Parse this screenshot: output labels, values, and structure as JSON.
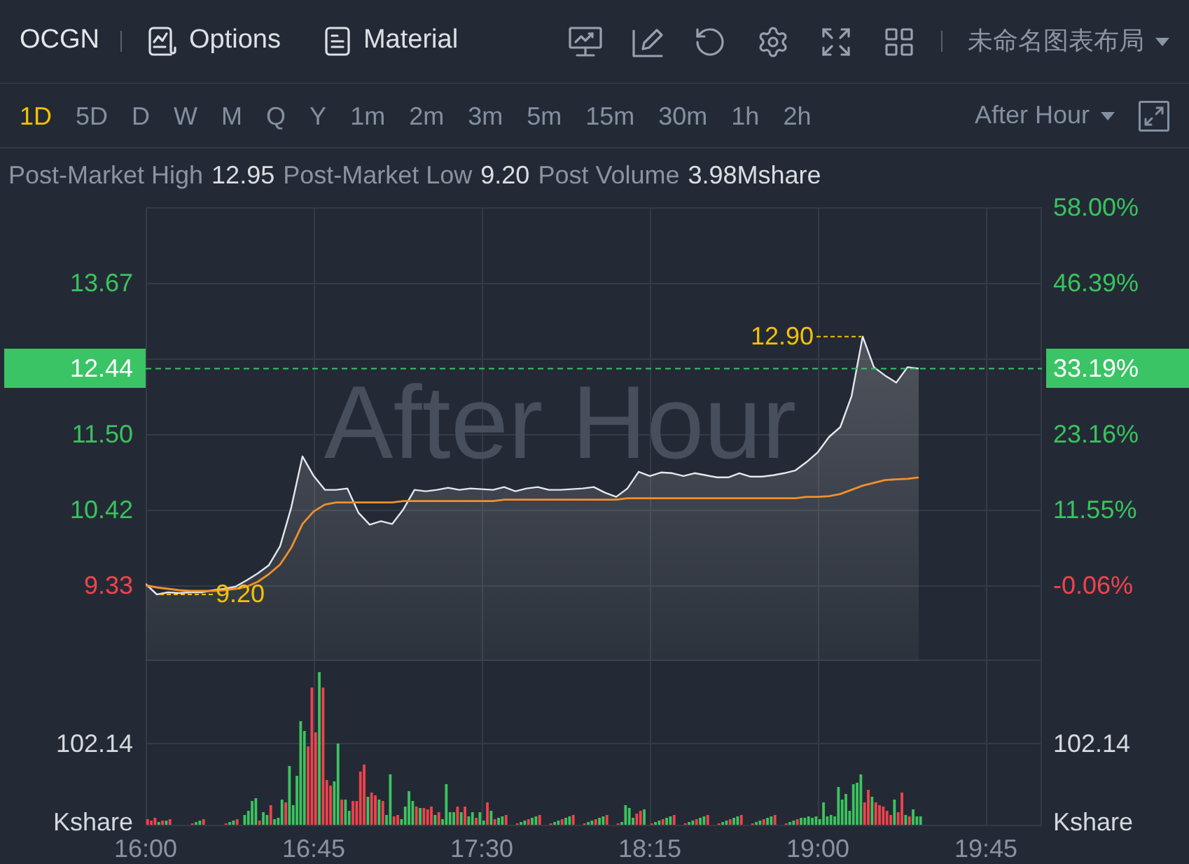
{
  "header": {
    "symbol": "OCGN",
    "buttons": [
      {
        "label": "Options",
        "kind": "options"
      },
      {
        "label": "Material",
        "kind": "material"
      }
    ],
    "layout_menu": "未命名图表布局"
  },
  "toolbar": {
    "periods": [
      {
        "label": "1D",
        "selected": true
      },
      {
        "label": "5D",
        "selected": false
      },
      {
        "label": "D",
        "selected": false
      },
      {
        "label": "W",
        "selected": false
      },
      {
        "label": "M",
        "selected": false
      },
      {
        "label": "Q",
        "selected": false
      },
      {
        "label": "Y",
        "selected": false
      },
      {
        "label": "1m",
        "selected": false
      },
      {
        "label": "2m",
        "selected": false
      },
      {
        "label": "3m",
        "selected": false
      },
      {
        "label": "5m",
        "selected": false
      },
      {
        "label": "15m",
        "selected": false
      },
      {
        "label": "30m",
        "selected": false
      },
      {
        "label": "1h",
        "selected": false
      },
      {
        "label": "2h",
        "selected": false
      }
    ],
    "session_menu": "After Hour"
  },
  "stats": [
    {
      "label": "Post-Market High",
      "value": "12.95"
    },
    {
      "label": "Post-Market Low",
      "value": "9.20"
    },
    {
      "label": "Post Volume",
      "value": "3.98Mshare"
    }
  ],
  "price_chart": {
    "background_label": "After Hour",
    "last_change": "33.19%",
    "high_marker": "12.90",
    "low_marker": "9.20",
    "right_axis": [
      {
        "label": "58.00%",
        "color": "#38c35e"
      },
      {
        "label": "46.39%",
        "color": "#38c35e"
      },
      {
        "label": "23.16%",
        "color": "#38c35e"
      },
      {
        "label": "11.55%",
        "color": "#38c35e"
      },
      {
        "label": "-0.06%",
        "color": "#f0434d"
      }
    ],
    "chart_data": {
      "type": "line",
      "grid": true,
      "categories": [
        "16:00",
        null,
        null,
        null,
        null,
        null,
        null,
        null,
        null,
        null,
        null,
        null,
        null,
        null,
        null,
        "16:45",
        null,
        null,
        null,
        null,
        null,
        null,
        null,
        null,
        null,
        null,
        null,
        null,
        null,
        null,
        "17:30",
        null,
        null,
        null,
        null,
        null,
        null,
        null,
        null,
        null,
        null,
        null,
        null,
        null,
        null,
        "18:15",
        null,
        null,
        null,
        null,
        null,
        null,
        null,
        null,
        null,
        null,
        null,
        null,
        null,
        null,
        "19:00",
        null,
        null,
        null,
        null,
        null,
        null,
        null,
        null,
        null,
        null,
        null,
        null,
        null,
        null,
        "19:45",
        null,
        null,
        null,
        null,
        null
      ],
      "series": [
        {
          "color": "#e4e7ec",
          "values": [
            9.35,
            9.2,
            9.23,
            9.22,
            9.23,
            9.23,
            9.26,
            9.28,
            9.31,
            9.4,
            9.5,
            9.62,
            9.89,
            10.45,
            11.18,
            10.9,
            10.7,
            10.7,
            10.72,
            10.37,
            10.2,
            10.25,
            10.21,
            10.42,
            10.7,
            10.68,
            10.7,
            10.73,
            10.7,
            10.72,
            10.71,
            10.7,
            10.74,
            10.68,
            10.72,
            10.74,
            10.7,
            10.7,
            10.71,
            10.72,
            10.74,
            10.66,
            10.6,
            10.72,
            10.96,
            10.9,
            10.95,
            10.94,
            10.9,
            10.94,
            10.91,
            10.88,
            10.88,
            10.94,
            10.89,
            10.89,
            10.91,
            10.94,
            10.98,
            11.1,
            11.24,
            11.46,
            11.6,
            12.04,
            12.9,
            12.46,
            12.34,
            12.24,
            12.46,
            12.44,
            null,
            null,
            null,
            null,
            null,
            null,
            null,
            null,
            null,
            null,
            null
          ]
        },
        {
          "color": "#f0902c",
          "values": [
            9.33,
            9.3,
            9.28,
            9.26,
            9.25,
            9.25,
            9.25,
            9.26,
            9.28,
            9.31,
            9.38,
            9.49,
            9.63,
            9.87,
            10.21,
            10.39,
            10.49,
            10.52,
            10.52,
            10.52,
            10.52,
            10.52,
            10.52,
            10.54,
            10.54,
            10.54,
            10.54,
            10.54,
            10.54,
            10.54,
            10.54,
            10.54,
            10.56,
            10.56,
            10.56,
            10.56,
            10.56,
            10.56,
            10.56,
            10.56,
            10.56,
            10.56,
            10.56,
            10.58,
            10.58,
            10.58,
            10.58,
            10.58,
            10.58,
            10.58,
            10.58,
            10.58,
            10.58,
            10.58,
            10.58,
            10.58,
            10.58,
            10.58,
            10.58,
            10.6,
            10.6,
            10.61,
            10.64,
            10.7,
            10.76,
            10.8,
            10.84,
            10.85,
            10.86,
            10.88,
            null,
            null,
            null,
            null,
            null,
            null,
            null,
            null,
            null,
            null,
            null
          ]
        }
      ],
      "ylim": [
        5.874,
        14.755
      ],
      "yticks": [
        {
          "value": 9.33,
          "label": "9.33"
        },
        {
          "value": 10.42,
          "label": "10.42"
        },
        {
          "value": 11.5,
          "label": "11.50"
        },
        {
          "value": 13.67,
          "label": "13.67"
        }
      ],
      "ref_lines": [
        {
          "axis": "y",
          "value": 12.44,
          "label": "12.44",
          "color": "#3ac465"
        }
      ]
    }
  },
  "volume_axis": {
    "left": {
      "value": "102.14",
      "unit": "Kshare"
    },
    "right": {
      "value": "102.14",
      "unit": "Kshare"
    }
  }
}
